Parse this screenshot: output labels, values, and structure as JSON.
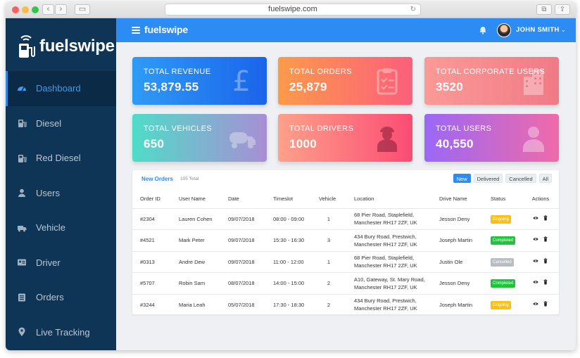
{
  "browser": {
    "url": "fuelswipe.com"
  },
  "sidebar": {
    "logo_text": "fuelswipe",
    "items": [
      {
        "label": "Dashboard",
        "icon": "dashboard-icon"
      },
      {
        "label": "Diesel",
        "icon": "fuel-pump-icon"
      },
      {
        "label": "Red Diesel",
        "icon": "fuel-pump-icon"
      },
      {
        "label": "Users",
        "icon": "user-icon"
      },
      {
        "label": "Vehicle",
        "icon": "truck-icon"
      },
      {
        "label": "Driver",
        "icon": "id-card-icon"
      },
      {
        "label": "Orders",
        "icon": "list-icon"
      },
      {
        "label": "Live Tracking",
        "icon": "location-pin-icon"
      }
    ]
  },
  "topbar": {
    "brand": "fuelswipe",
    "user_name": "JOHN SMITH"
  },
  "stats": [
    {
      "label": "TOTAL REVENUE",
      "value": "53,879.55",
      "icon": "pound-icon"
    },
    {
      "label": "TOTAL ORDERS",
      "value": "25,879",
      "icon": "clipboard-icon"
    },
    {
      "label": "TOTAL CORPORATE USERS",
      "value": "3520",
      "icon": "building-icon"
    },
    {
      "label": "TOTAL VEHICLES",
      "value": "650",
      "icon": "tanker-icon"
    },
    {
      "label": "TOTAL DRIVERS",
      "value": "1000",
      "icon": "driver-icon"
    },
    {
      "label": "TOTAL USERS",
      "value": "40,550",
      "icon": "user-icon"
    }
  ],
  "orders": {
    "title": "New Orders",
    "total": "105 Total",
    "filters": [
      "New",
      "Delivered",
      "Cancelled",
      "All"
    ],
    "columns": [
      "Order ID",
      "User Name",
      "Date",
      "Timeslot",
      "Vehicle",
      "Location",
      "Drive Name",
      "Status",
      "Actions"
    ],
    "rows": [
      {
        "id": "#2304",
        "user": "Lauren Cohen",
        "date": "09/07/2018",
        "timeslot": "08:00 - 09:00",
        "vehicle": "1",
        "loc1": "68  Pier Road, Staplefield,",
        "loc2": "Manchester RH17 2ZF, UK",
        "driver": "Jesson Deny",
        "status": "Ongoing"
      },
      {
        "id": "#4521",
        "user": "Mark Peter",
        "date": "09/07/2018",
        "timeslot": "15:30 - 16:30",
        "vehicle": "3",
        "loc1": "434 Bury Road, Prestwich,",
        "loc2": "Manchester RH17 2ZF, UK",
        "driver": "Joseph Martin",
        "status": "Completed"
      },
      {
        "id": "#0313",
        "user": "Andre Dew",
        "date": "09/07/2018",
        "timeslot": "11:00 - 12:00",
        "vehicle": "1",
        "loc1": "68  Pier Road, Staplefield,",
        "loc2": "Manchester RH17 2ZF, UK",
        "driver": "Justin Ole",
        "status": "Cancelled"
      },
      {
        "id": "#5707",
        "user": "Robin Sam",
        "date": "08/07/2018",
        "timeslot": "14:00 - 15:00",
        "vehicle": "2",
        "loc1": "A10, Gateway, St. Mary Road,",
        "loc2": "Manchester RH17 2ZF, UK",
        "driver": "Jesson Deny",
        "status": "Completed"
      },
      {
        "id": "#3244",
        "user": "Maria Leah",
        "date": "05/07/2018",
        "timeslot": "17:30 - 18:30",
        "vehicle": "2",
        "loc1": "434 Bury Road, Prestwich,",
        "loc2": "Manchester RH17 2ZF, UK",
        "driver": "Joseph Martin",
        "status": "Ongoing"
      }
    ]
  },
  "colors": {
    "topbar": "#2c8cf4",
    "sidebar": "#0f3556",
    "ongoing": "#fcc012",
    "completed": "#1fc43a",
    "cancelled": "#b9bdc1"
  }
}
